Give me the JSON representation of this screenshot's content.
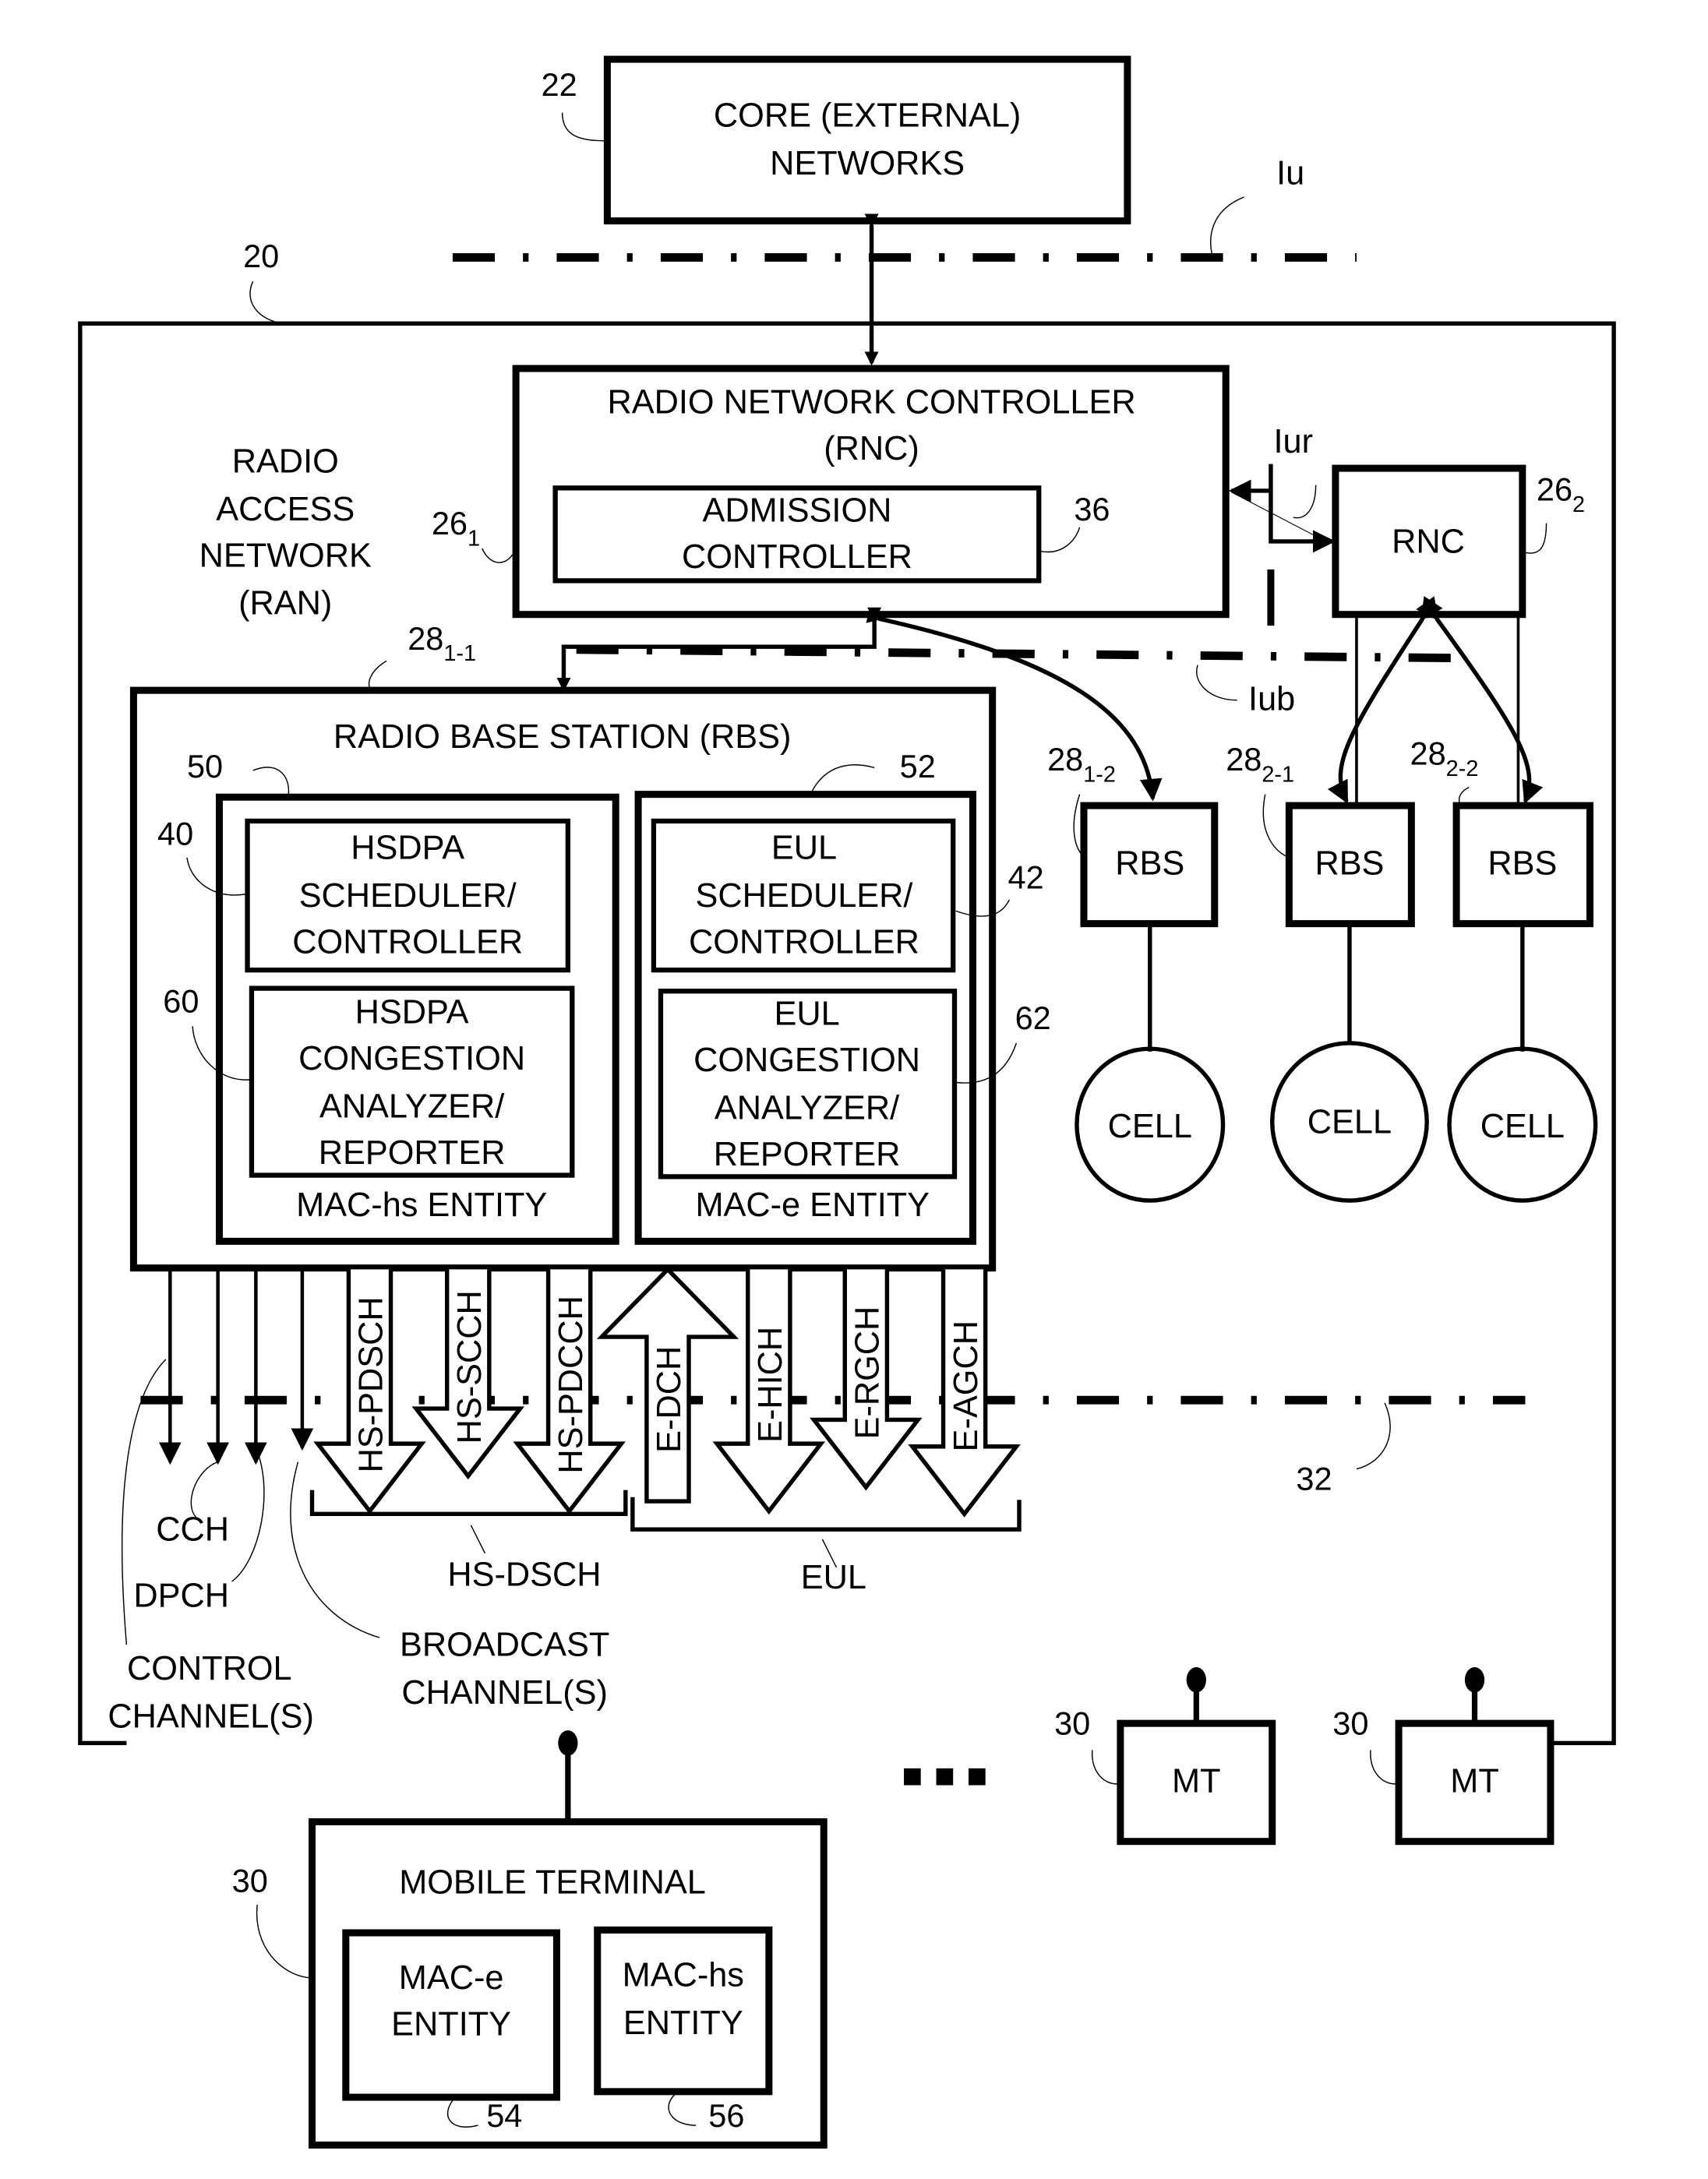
{
  "figure": {
    "core_network": {
      "ref": "22",
      "lines": [
        "CORE (EXTERNAL)",
        "NETWORKS"
      ]
    },
    "interfaces": {
      "iu": "Iu",
      "iur": "Iur",
      "iub": "Iub"
    },
    "ran": {
      "ref": "20",
      "lines": [
        "RADIO",
        "ACCESS",
        "NETWORK",
        "(RAN)"
      ]
    },
    "rnc_main": {
      "ref_base": "26",
      "ref_sub": "1",
      "lines": [
        "RADIO NETWORK CONTROLLER",
        "(RNC)"
      ],
      "admission": {
        "ref": "36",
        "lines": [
          "ADMISSION",
          "CONTROLLER"
        ]
      }
    },
    "rnc_second": {
      "ref_base": "26",
      "ref_sub": "2",
      "label": "RNC"
    },
    "rbs_main": {
      "ref_base": "28",
      "ref_sub": "1-1",
      "title": "RADIO BASE STATION (RBS)",
      "mac_hs": {
        "ref": "50",
        "label": "MAC-hs ENTITY",
        "scheduler": {
          "ref": "40",
          "lines": [
            "HSDPA",
            "SCHEDULER/",
            "CONTROLLER"
          ]
        },
        "congestion": {
          "ref": "60",
          "lines": [
            "HSDPA",
            "CONGESTION",
            "ANALYZER/",
            "REPORTER"
          ]
        }
      },
      "mac_e": {
        "ref": "52",
        "label": "MAC-e ENTITY",
        "scheduler": {
          "ref": "42",
          "lines": [
            "EUL",
            "SCHEDULER/",
            "CONTROLLER"
          ]
        },
        "congestion": {
          "ref": "62",
          "lines": [
            "EUL",
            "CONGESTION",
            "ANALYZER/",
            "REPORTER"
          ]
        }
      }
    },
    "other_rbs": [
      {
        "ref_base": "28",
        "ref_sub": "1-2",
        "label": "RBS",
        "cell": "CELL"
      },
      {
        "ref_base": "28",
        "ref_sub": "2-1",
        "label": "RBS",
        "cell": "CELL"
      },
      {
        "ref_base": "28",
        "ref_sub": "2-2",
        "label": "RBS",
        "cell": "CELL"
      }
    ],
    "air_interface_ref": "32",
    "channels": {
      "hs_dsch": [
        "HS-PDSCH",
        "HS-SCCH",
        "HS-PDCCH"
      ],
      "eul": [
        "E-DCH",
        "E-HICH",
        "E-RGCH",
        "E-AGCH"
      ],
      "hs_dsch_group": "HS-DSCH",
      "eul_group": "EUL",
      "cch": "CCH",
      "dpch": "DPCH",
      "control": [
        "CONTROL",
        "CHANNEL(S)"
      ],
      "broadcast": [
        "BROADCAST",
        "CHANNEL(S)"
      ]
    },
    "mobile_terminal": {
      "ref": "30",
      "title": "MOBILE TERMINAL",
      "mac_e": {
        "ref": "54",
        "lines": [
          "MAC-e",
          "ENTITY"
        ]
      },
      "mac_hs": {
        "ref": "56",
        "lines": [
          "MAC-hs",
          "ENTITY"
        ]
      }
    },
    "small_terminals": [
      {
        "ref": "30",
        "label": "MT"
      },
      {
        "ref": "30",
        "label": "MT"
      }
    ],
    "ellipsis": "..."
  }
}
